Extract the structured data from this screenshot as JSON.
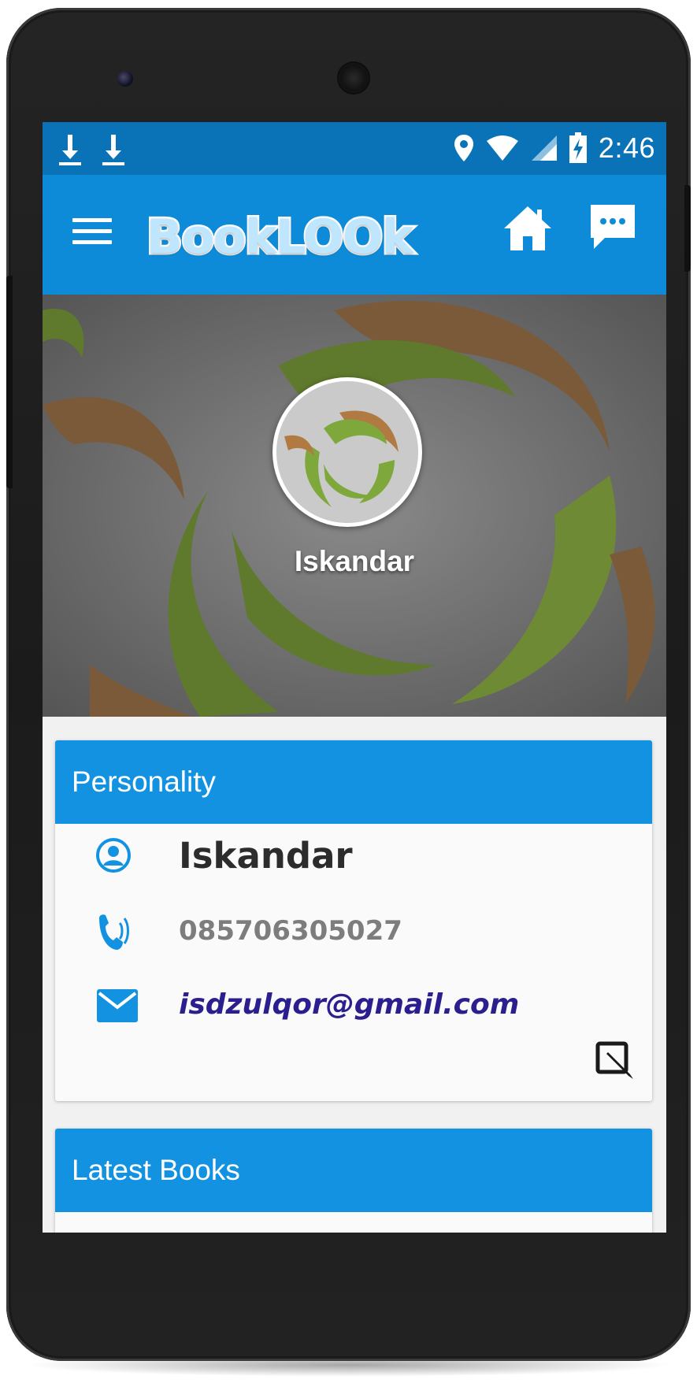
{
  "status_bar": {
    "time": "2:46",
    "icons": [
      "download-icon",
      "download-icon",
      "location-icon",
      "wifi-icon",
      "signal-icon",
      "battery-charging-icon"
    ]
  },
  "app_bar": {
    "logo_text": "BookLOOk",
    "menu_icon": "hamburger-menu-icon",
    "home_icon": "home-icon",
    "chat_icon": "chat-icon"
  },
  "profile": {
    "cover_name": "Iskandar"
  },
  "personality": {
    "title": "Personality",
    "name": "Iskandar",
    "phone": "085706305027",
    "email": "isdzulqor@gmail.com",
    "edit_icon": "edit-icon"
  },
  "latest_books": {
    "title": "Latest Books"
  },
  "colors": {
    "status_bar": "#0a73b8",
    "app_bar": "#0d8bd9",
    "card_header": "#1492e2",
    "email": "#2b1e8f"
  }
}
